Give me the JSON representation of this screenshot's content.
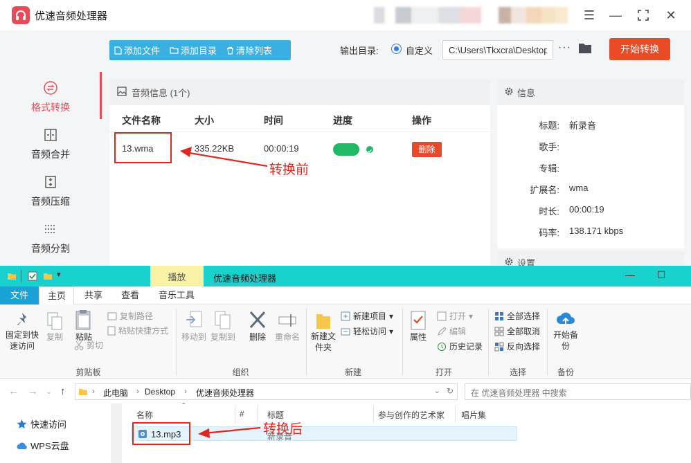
{
  "app": {
    "title": "优速音频处理器",
    "toolbar": {
      "add_file": "添加文件",
      "add_dir": "添加目录",
      "clear_list": "清除列表"
    },
    "output": {
      "label": "输出目录:",
      "option": "自定义",
      "path": "C:\\Users\\Tkxcra\\Desktop"
    },
    "start_button": "开始转换",
    "sidebar": [
      {
        "label": "格式转换",
        "icon": "convert-icon",
        "active": true
      },
      {
        "label": "音频合并",
        "icon": "merge-icon",
        "active": false
      },
      {
        "label": "音频压缩",
        "icon": "compress-icon",
        "active": false
      },
      {
        "label": "音频分割",
        "icon": "split-icon",
        "active": false
      }
    ],
    "panel": {
      "heading": "音频信息 (1个)",
      "columns": [
        "文件名称",
        "大小",
        "时间",
        "进度",
        "操作"
      ],
      "rows": [
        {
          "name": "13.wma",
          "size": "335.22KB",
          "time": "00:00:19",
          "progress": 1.0,
          "action": "删除"
        }
      ]
    },
    "info": {
      "heading": "信息",
      "fields": [
        {
          "key": "标题:",
          "value": "新录音"
        },
        {
          "key": "歌手:",
          "value": ""
        },
        {
          "key": "专辑:",
          "value": ""
        },
        {
          "key": "扩展名:",
          "value": "wma"
        },
        {
          "key": "时长:",
          "value": "00:00:19"
        },
        {
          "key": "码率:",
          "value": "138.171 kbps"
        }
      ]
    },
    "settings_heading": "设置"
  },
  "annotations": {
    "before": "转换前",
    "after": "转换后"
  },
  "explorer": {
    "contextual_tab": "播放",
    "title": "优速音频处理器",
    "tabs": {
      "file": "文件",
      "home": "主页",
      "share": "共享",
      "view": "查看",
      "music_tools": "音乐工具"
    },
    "ribbon": {
      "pin_quick": "固定到快速访问",
      "copy": "复制",
      "paste": "粘贴",
      "copy_path": "复制路径",
      "paste_shortcut": "粘贴快捷方式",
      "cut": "剪切",
      "clipboard": "剪贴板",
      "move_to": "移动到",
      "copy_to": "复制到",
      "delete": "删除",
      "rename": "重命名",
      "organize": "组织",
      "new_folder": "新建文件夹",
      "new_item": "新建项目",
      "easy_access": "轻松访问",
      "new_group": "新建",
      "properties": "属性",
      "open": "打开",
      "edit": "编辑",
      "history": "历史记录",
      "open_group": "打开",
      "select_all": "全部选择",
      "select_none": "全部取消",
      "invert_select": "反向选择",
      "select_group": "选择",
      "start_backup": "开始备份",
      "backup_group": "备份"
    },
    "breadcrumb": [
      "此电脑",
      "Desktop",
      "优速音频处理器"
    ],
    "search_placeholder": "在 优速音频处理器 中搜索",
    "nav": [
      {
        "label": "快速访问",
        "icon": "star-icon"
      },
      {
        "label": "WPS云盘",
        "icon": "cloud-icon"
      }
    ],
    "columns": [
      "名称",
      "#",
      "标题",
      "参与创作的艺术家",
      "唱片集"
    ],
    "files": [
      {
        "name": "13.mp3",
        "title": "新录音"
      }
    ]
  },
  "colors": {
    "accent": "#e84b57",
    "toolbar_blue": "#3ab0e2",
    "start_orange": "#ea4b26",
    "explorer_titlebar": "#19d2ce",
    "annotation_red": "#e0271d"
  }
}
